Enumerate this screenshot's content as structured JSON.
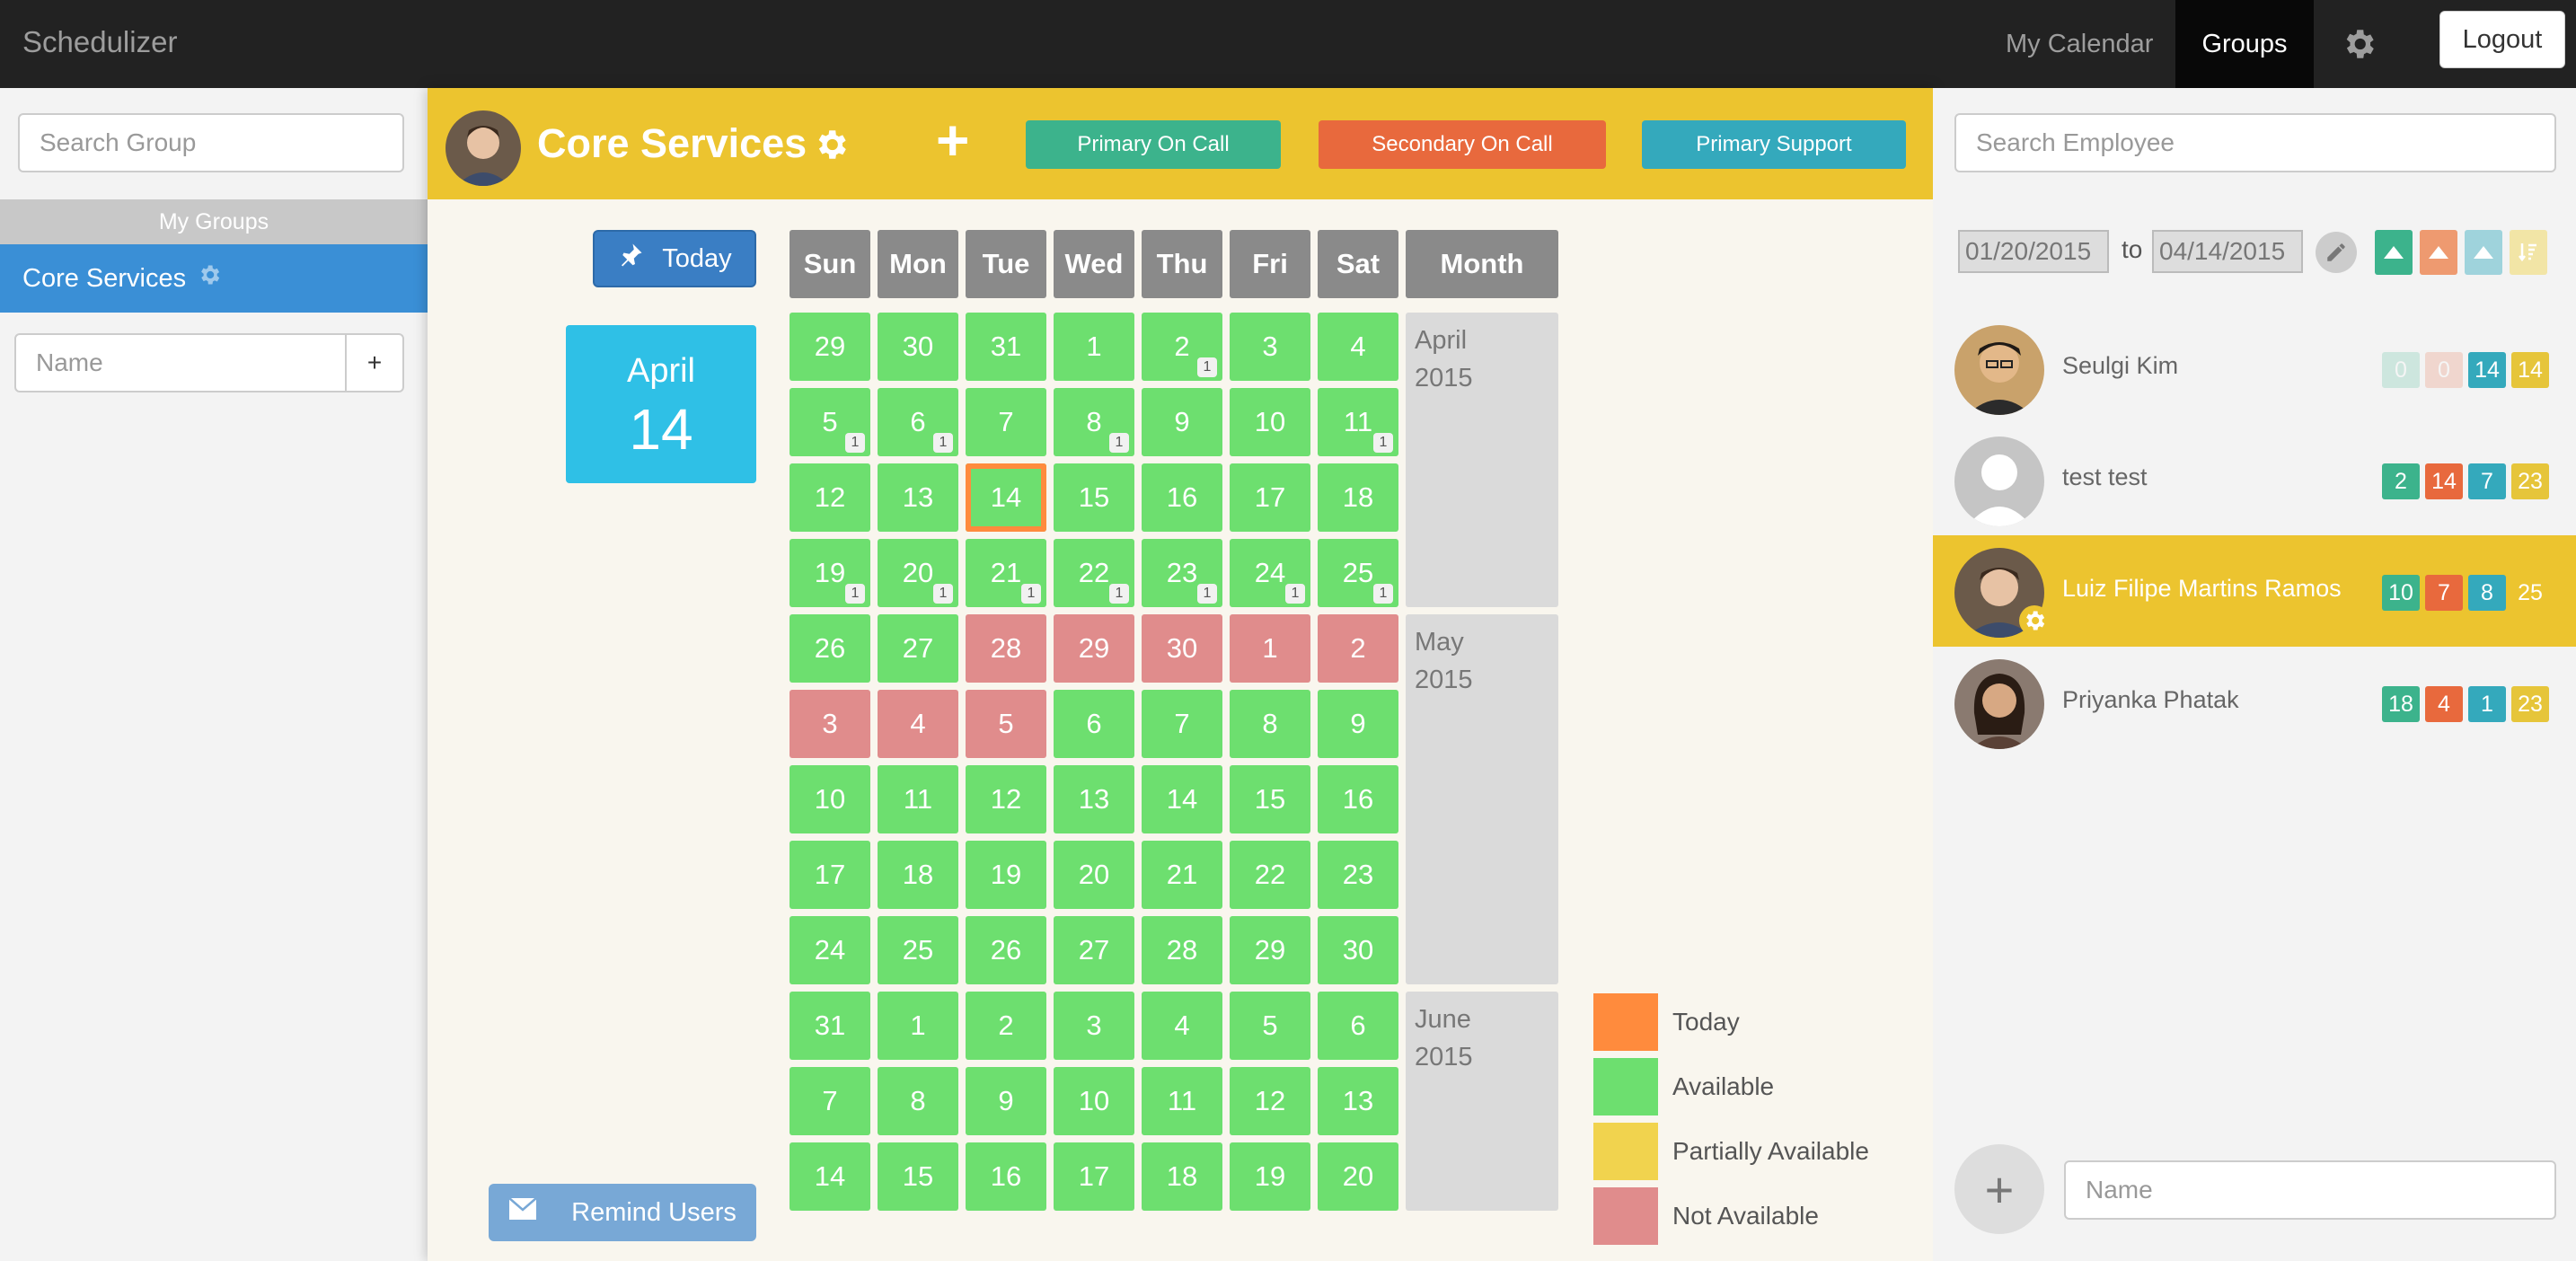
{
  "app": {
    "brand": "Schedulizer"
  },
  "nav": {
    "my_calendar": "My Calendar",
    "groups": "Groups",
    "logout": "Logout"
  },
  "left": {
    "search_placeholder": "Search Group",
    "section_title": "My Groups",
    "groups": [
      {
        "label": "Core Services"
      }
    ],
    "name_placeholder": "Name",
    "add_label": "+"
  },
  "group": {
    "title": "Core Services",
    "add_label": "+",
    "roles": [
      {
        "label": "Primary On Call",
        "color": "#3cb38c"
      },
      {
        "label": "Secondary On Call",
        "color": "#e8693d"
      },
      {
        "label": "Primary Support",
        "color": "#34a9bc"
      }
    ]
  },
  "calendar": {
    "today_label": "Today",
    "selected_month": "April",
    "selected_day": "14",
    "remind_label": "Remind Users",
    "month_col_header": "Month",
    "weekdays": [
      "Sun",
      "Mon",
      "Tue",
      "Wed",
      "Thu",
      "Fri",
      "Sat"
    ],
    "months": [
      {
        "label": "April\n2015"
      },
      {
        "label": "May\n2015"
      },
      {
        "label": "June\n2015"
      }
    ],
    "weeks": [
      [
        {
          "d": "29",
          "s": "g"
        },
        {
          "d": "30",
          "s": "g"
        },
        {
          "d": "31",
          "s": "g"
        },
        {
          "d": "1",
          "s": "g"
        },
        {
          "d": "2",
          "s": "g",
          "b": "1"
        },
        {
          "d": "3",
          "s": "g"
        },
        {
          "d": "4",
          "s": "g"
        }
      ],
      [
        {
          "d": "5",
          "s": "g",
          "b": "1"
        },
        {
          "d": "6",
          "s": "g",
          "b": "1"
        },
        {
          "d": "7",
          "s": "g"
        },
        {
          "d": "8",
          "s": "g",
          "b": "1"
        },
        {
          "d": "9",
          "s": "g"
        },
        {
          "d": "10",
          "s": "g"
        },
        {
          "d": "11",
          "s": "g",
          "b": "1"
        }
      ],
      [
        {
          "d": "12",
          "s": "g"
        },
        {
          "d": "13",
          "s": "g"
        },
        {
          "d": "14",
          "s": "g",
          "today": true
        },
        {
          "d": "15",
          "s": "g"
        },
        {
          "d": "16",
          "s": "g"
        },
        {
          "d": "17",
          "s": "g"
        },
        {
          "d": "18",
          "s": "g"
        }
      ],
      [
        {
          "d": "19",
          "s": "g",
          "b": "1"
        },
        {
          "d": "20",
          "s": "g",
          "b": "1"
        },
        {
          "d": "21",
          "s": "g",
          "b": "1"
        },
        {
          "d": "22",
          "s": "g",
          "b": "1"
        },
        {
          "d": "23",
          "s": "g",
          "b": "1"
        },
        {
          "d": "24",
          "s": "g",
          "b": "1"
        },
        {
          "d": "25",
          "s": "g",
          "b": "1"
        }
      ],
      [
        {
          "d": "26",
          "s": "g"
        },
        {
          "d": "27",
          "s": "g"
        },
        {
          "d": "28",
          "s": "r"
        },
        {
          "d": "29",
          "s": "r"
        },
        {
          "d": "30",
          "s": "r"
        },
        {
          "d": "1",
          "s": "r"
        },
        {
          "d": "2",
          "s": "r"
        }
      ],
      [
        {
          "d": "3",
          "s": "r"
        },
        {
          "d": "4",
          "s": "r"
        },
        {
          "d": "5",
          "s": "r"
        },
        {
          "d": "6",
          "s": "g"
        },
        {
          "d": "7",
          "s": "g"
        },
        {
          "d": "8",
          "s": "g"
        },
        {
          "d": "9",
          "s": "g"
        }
      ],
      [
        {
          "d": "10",
          "s": "g"
        },
        {
          "d": "11",
          "s": "g"
        },
        {
          "d": "12",
          "s": "g"
        },
        {
          "d": "13",
          "s": "g"
        },
        {
          "d": "14",
          "s": "g"
        },
        {
          "d": "15",
          "s": "g"
        },
        {
          "d": "16",
          "s": "g"
        }
      ],
      [
        {
          "d": "17",
          "s": "g"
        },
        {
          "d": "18",
          "s": "g"
        },
        {
          "d": "19",
          "s": "g"
        },
        {
          "d": "20",
          "s": "g"
        },
        {
          "d": "21",
          "s": "g"
        },
        {
          "d": "22",
          "s": "g"
        },
        {
          "d": "23",
          "s": "g"
        }
      ],
      [
        {
          "d": "24",
          "s": "g"
        },
        {
          "d": "25",
          "s": "g"
        },
        {
          "d": "26",
          "s": "g"
        },
        {
          "d": "27",
          "s": "g"
        },
        {
          "d": "28",
          "s": "g"
        },
        {
          "d": "29",
          "s": "g"
        },
        {
          "d": "30",
          "s": "g"
        }
      ],
      [
        {
          "d": "31",
          "s": "g"
        },
        {
          "d": "1",
          "s": "g"
        },
        {
          "d": "2",
          "s": "g"
        },
        {
          "d": "3",
          "s": "g"
        },
        {
          "d": "4",
          "s": "g"
        },
        {
          "d": "5",
          "s": "g"
        },
        {
          "d": "6",
          "s": "g"
        }
      ],
      [
        {
          "d": "7",
          "s": "g"
        },
        {
          "d": "8",
          "s": "g"
        },
        {
          "d": "9",
          "s": "g"
        },
        {
          "d": "10",
          "s": "g"
        },
        {
          "d": "11",
          "s": "g"
        },
        {
          "d": "12",
          "s": "g"
        },
        {
          "d": "13",
          "s": "g"
        }
      ],
      [
        {
          "d": "14",
          "s": "g"
        },
        {
          "d": "15",
          "s": "g"
        },
        {
          "d": "16",
          "s": "g"
        },
        {
          "d": "17",
          "s": "g"
        },
        {
          "d": "18",
          "s": "g"
        },
        {
          "d": "19",
          "s": "g"
        },
        {
          "d": "20",
          "s": "g"
        }
      ]
    ]
  },
  "legend": [
    {
      "label": "Today",
      "color": "#ff8b3d"
    },
    {
      "label": "Available",
      "color": "#6ddf6f"
    },
    {
      "label": "Partially Available",
      "color": "#f1d34e"
    },
    {
      "label": "Not Available",
      "color": "#e08c8c"
    }
  ],
  "right": {
    "search_placeholder": "Search Employee",
    "date_from": "01/20/2015",
    "to_label": "to",
    "date_to": "04/14/2015",
    "name_placeholder": "Name",
    "add_label": "+",
    "employees": [
      {
        "name": "Seulgi Kim",
        "counts": [
          "0",
          "0",
          "14",
          "14"
        ],
        "faded": [
          true,
          true,
          false,
          false
        ],
        "selected": false
      },
      {
        "name": "test test",
        "counts": [
          "2",
          "14",
          "7",
          "23"
        ],
        "faded": [
          false,
          false,
          false,
          false
        ],
        "selected": false
      },
      {
        "name": "Luiz Filipe Martins Ramos",
        "counts": [
          "10",
          "7",
          "8",
          "25"
        ],
        "faded": [
          false,
          false,
          false,
          false
        ],
        "selected": true
      },
      {
        "name": "Priyanka Phatak",
        "counts": [
          "18",
          "4",
          "1",
          "23"
        ],
        "faded": [
          false,
          false,
          false,
          false
        ],
        "selected": false
      }
    ],
    "count_colors": [
      "#3cb38c",
      "#e8693d",
      "#34a9bc",
      "#e6c53a"
    ]
  }
}
